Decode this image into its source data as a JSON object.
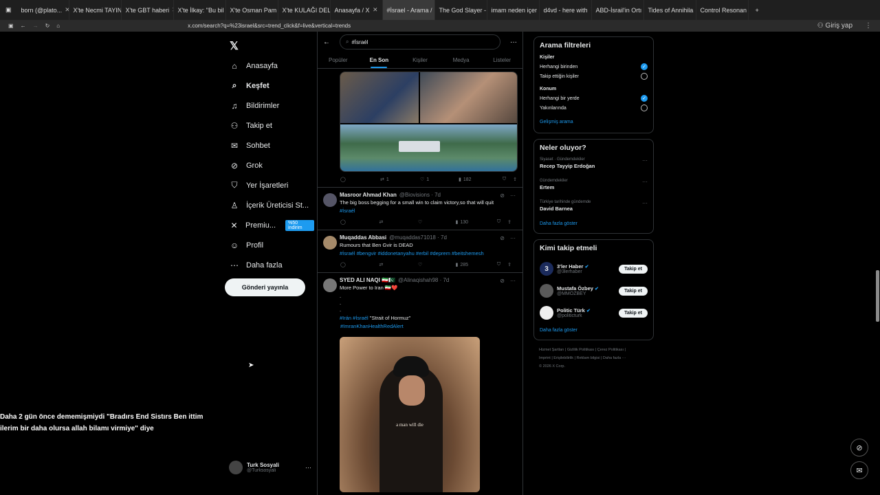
{
  "browser": {
    "tabs": [
      {
        "label": "born (@plato...",
        "active": false
      },
      {
        "label": "X'te Necmi TAYIN",
        "active": false
      },
      {
        "label": "X'te GBT haberi",
        "active": false
      },
      {
        "label": "X'te İlkay: \"Bu bil",
        "active": false
      },
      {
        "label": "X'te Osman Pam",
        "active": false
      },
      {
        "label": "X'te KULAĞI DELI",
        "active": false
      },
      {
        "label": "Anasayfa / X",
        "active": false
      },
      {
        "label": "#İsrael - Arama /",
        "active": true
      },
      {
        "label": "The God Slayer -",
        "active": false
      },
      {
        "label": "imam neden içer",
        "active": false
      },
      {
        "label": "d4vd - here with",
        "active": false
      },
      {
        "label": "ABD-İsrail'in Ortı",
        "active": false
      },
      {
        "label": "Tides of Annihila",
        "active": false
      },
      {
        "label": "Control Resonan",
        "active": false
      }
    ],
    "url": "x.com/search?q=%23israel&src=trend_click&f=live&vertical=trends",
    "profile_label": "Giriş yap"
  },
  "nav": {
    "items": [
      {
        "label": "Anasayfa",
        "icon": "home-icon",
        "glyph": "⌂",
        "bold": false
      },
      {
        "label": "Keşfet",
        "icon": "search-icon",
        "glyph": "⌕",
        "bold": true
      },
      {
        "label": "Bildirimler",
        "icon": "bell-icon",
        "glyph": "♫",
        "bold": false
      },
      {
        "label": "Takip et",
        "icon": "follow-icon",
        "glyph": "⚇",
        "bold": false
      },
      {
        "label": "Sohbet",
        "icon": "mail-icon",
        "glyph": "✉",
        "bold": false
      },
      {
        "label": "Grok",
        "icon": "grok-icon",
        "glyph": "⊘",
        "bold": false
      },
      {
        "label": "Yer İşaretleri",
        "icon": "bookmark-icon",
        "glyph": "⛉",
        "bold": false
      },
      {
        "label": "İçerik Üreticisi St...",
        "icon": "creator-icon",
        "glyph": "♙",
        "bold": false
      },
      {
        "label": "Premiu...",
        "icon": "x-logo-icon",
        "glyph": "✕",
        "bold": false,
        "badge": "%50 indirim"
      },
      {
        "label": "Profil",
        "icon": "profile-icon",
        "glyph": "☺",
        "bold": false
      },
      {
        "label": "Daha fazla",
        "icon": "more-icon",
        "glyph": "⋯",
        "bold": false
      }
    ],
    "post_button": "Gönderi yayınla",
    "user": {
      "name": "Turk Sosyali",
      "handle": "@Turksosyali"
    }
  },
  "subtitle": {
    "line1": "Daha 2 gün önce dememişmiydi \"Bradırs End Sistırs Ben ittim",
    "line2": "ilerim bir daha olursa allah bilamı virmiye\" diye"
  },
  "search": {
    "value": "#İsraél",
    "tabs": [
      "Popüler",
      "En Son",
      "Kişiler",
      "Medya",
      "Listeler"
    ],
    "active_tab": "En Son"
  },
  "first_post_actions": {
    "retweets": "1",
    "likes": "1",
    "views": "182"
  },
  "posts": [
    {
      "name": "Masroor Ahmad Khan",
      "handle": "@Biovisions · 7d",
      "text": "The big boss begging for a small win to claim victory,so that will quit",
      "tags": "#İsraél",
      "views": "130"
    },
    {
      "name": "Muqaddas Abbasi",
      "handle": "@muqaddas71018 · 7d",
      "text": "Rumours that Ben Gvir is DEAD",
      "tags": "#İsraél #bengvir #iddonetanyahu #erbil #deprem #beitshemesh",
      "views": "285"
    },
    {
      "name": "SYED ALI NAQI 🇮🇷🇵🇰",
      "handle": "@Alinaqishah98 · 7d",
      "text": "More Power to Iran 🇮🇷❤️",
      "dots": ".\n.\n.",
      "tags_prefix": "#Irán #İsraél",
      "tags_suffix": " \"Strait of Hormuz\"",
      "tags2": "#ImranKhanHealthRedAlert",
      "media_caption": "a man will die"
    }
  ],
  "filters": {
    "title": "Arama filtreleri",
    "people_title": "Kişiler",
    "people": [
      {
        "label": "Herhangi birinden",
        "checked": true
      },
      {
        "label": "Takip ettiğin kişiler",
        "checked": false
      }
    ],
    "location_title": "Konum",
    "location": [
      {
        "label": "Herhangi bir yerde",
        "checked": true
      },
      {
        "label": "Yakınlarında",
        "checked": false
      }
    ],
    "advanced": "Gelişmiş arama"
  },
  "trends": {
    "title": "Neler oluyor?",
    "items": [
      {
        "context": "Siyaset · Gündemdekiler",
        "topic": "Recep Tayyip Erdoğan"
      },
      {
        "context": "Gündemdekiler",
        "topic": "Ertem"
      },
      {
        "context": "Türkiye tarihinde gündemde",
        "topic": "David Barnea"
      }
    ],
    "more": "Daha fazla göster"
  },
  "who_to_follow": {
    "title": "Kimi takip etmeli",
    "items": [
      {
        "name": "3'ler Haber",
        "handle": "@3lerhaber",
        "avatar": "3"
      },
      {
        "name": "Mustafa Özbey",
        "handle": "@MMOZBEY",
        "avatar": ""
      },
      {
        "name": "Politic Türk",
        "handle": "@politicturk",
        "avatar": ""
      }
    ],
    "button": "Takip et",
    "more": "Daha fazla göster"
  },
  "footer": {
    "line1": "Hizmet Şartları | Gizlilik Politikası | Çerez Politikası |",
    "line2": "Imprint | Erişilebilirlik | Reklam bilgisi | Daha fazla ···",
    "line3": "© 2026 X Corp."
  },
  "colors": {
    "accent": "#1d9bf0",
    "background": "#000000",
    "text": "#e7e9ea",
    "muted": "#71767b",
    "border": "#2f3336"
  }
}
